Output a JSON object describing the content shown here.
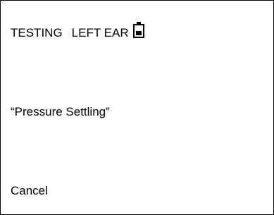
{
  "header": {
    "mode": "TESTING",
    "ear": "LEFT EAR",
    "battery_icon": "battery-icon",
    "battery_level": 0.5
  },
  "main": {
    "status_message": "“Pressure Settling”"
  },
  "footer": {
    "cancel_label": "Cancel"
  }
}
